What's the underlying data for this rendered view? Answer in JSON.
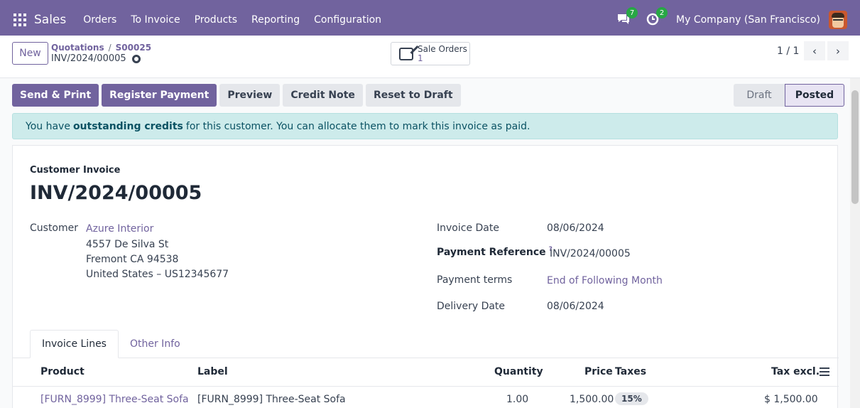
{
  "nav": {
    "app_name": "Sales",
    "menu": [
      "Orders",
      "To Invoice",
      "Products",
      "Reporting",
      "Configuration"
    ],
    "messages_badge": "7",
    "activities_badge": "2",
    "company": "My Company (San Francisco)"
  },
  "control": {
    "new_label": "New",
    "breadcrumb_parent": "Quotations",
    "breadcrumb_sep": "/",
    "breadcrumb_current": "S00025",
    "record_name": "INV/2024/00005",
    "smart_button_label": "Sale Orders",
    "smart_button_count": "1",
    "pager": "1 / 1",
    "pager_prev": "‹",
    "pager_next": "›"
  },
  "actions": {
    "send_print": "Send & Print",
    "register_payment": "Register Payment",
    "preview": "Preview",
    "credit_note": "Credit Note",
    "reset_to_draft": "Reset to Draft"
  },
  "status": {
    "draft": "Draft",
    "posted": "Posted"
  },
  "alert": {
    "prefix": "You have",
    "bold": "outstanding credits",
    "suffix": "for this customer. You can allocate them to mark this invoice as paid."
  },
  "invoice": {
    "type": "Customer Invoice",
    "number": "INV/2024/00005",
    "customer_label": "Customer",
    "customer_name": "Azure Interior",
    "address_line1": "4557 De Silva St",
    "address_line2": "Fremont CA 94538",
    "address_line3": "United States – US12345677",
    "invoice_date_label": "Invoice Date",
    "invoice_date": "08/06/2024",
    "payment_ref_label": "Payment Reference",
    "payment_ref_help": "?",
    "payment_ref": "INV/2024/00005",
    "payment_terms_label": "Payment terms",
    "payment_terms": "End of Following Month",
    "delivery_date_label": "Delivery Date",
    "delivery_date": "08/06/2024"
  },
  "tabs": [
    "Invoice Lines",
    "Other Info"
  ],
  "lines": {
    "columns": [
      "Product",
      "Label",
      "Quantity",
      "Price",
      "Taxes",
      "Tax excl."
    ],
    "rows": [
      {
        "product": "[FURN_8999] Three-Seat Sofa",
        "label": "[FURN_8999] Three-Seat Sofa",
        "quantity": "1.00",
        "price": "1,500.00",
        "taxes": "15%",
        "subtotal": "$ 1,500.00"
      }
    ]
  },
  "colors": {
    "brand": "#71639e",
    "alert_bg": "#cdebeb",
    "badge": "#28a745"
  }
}
